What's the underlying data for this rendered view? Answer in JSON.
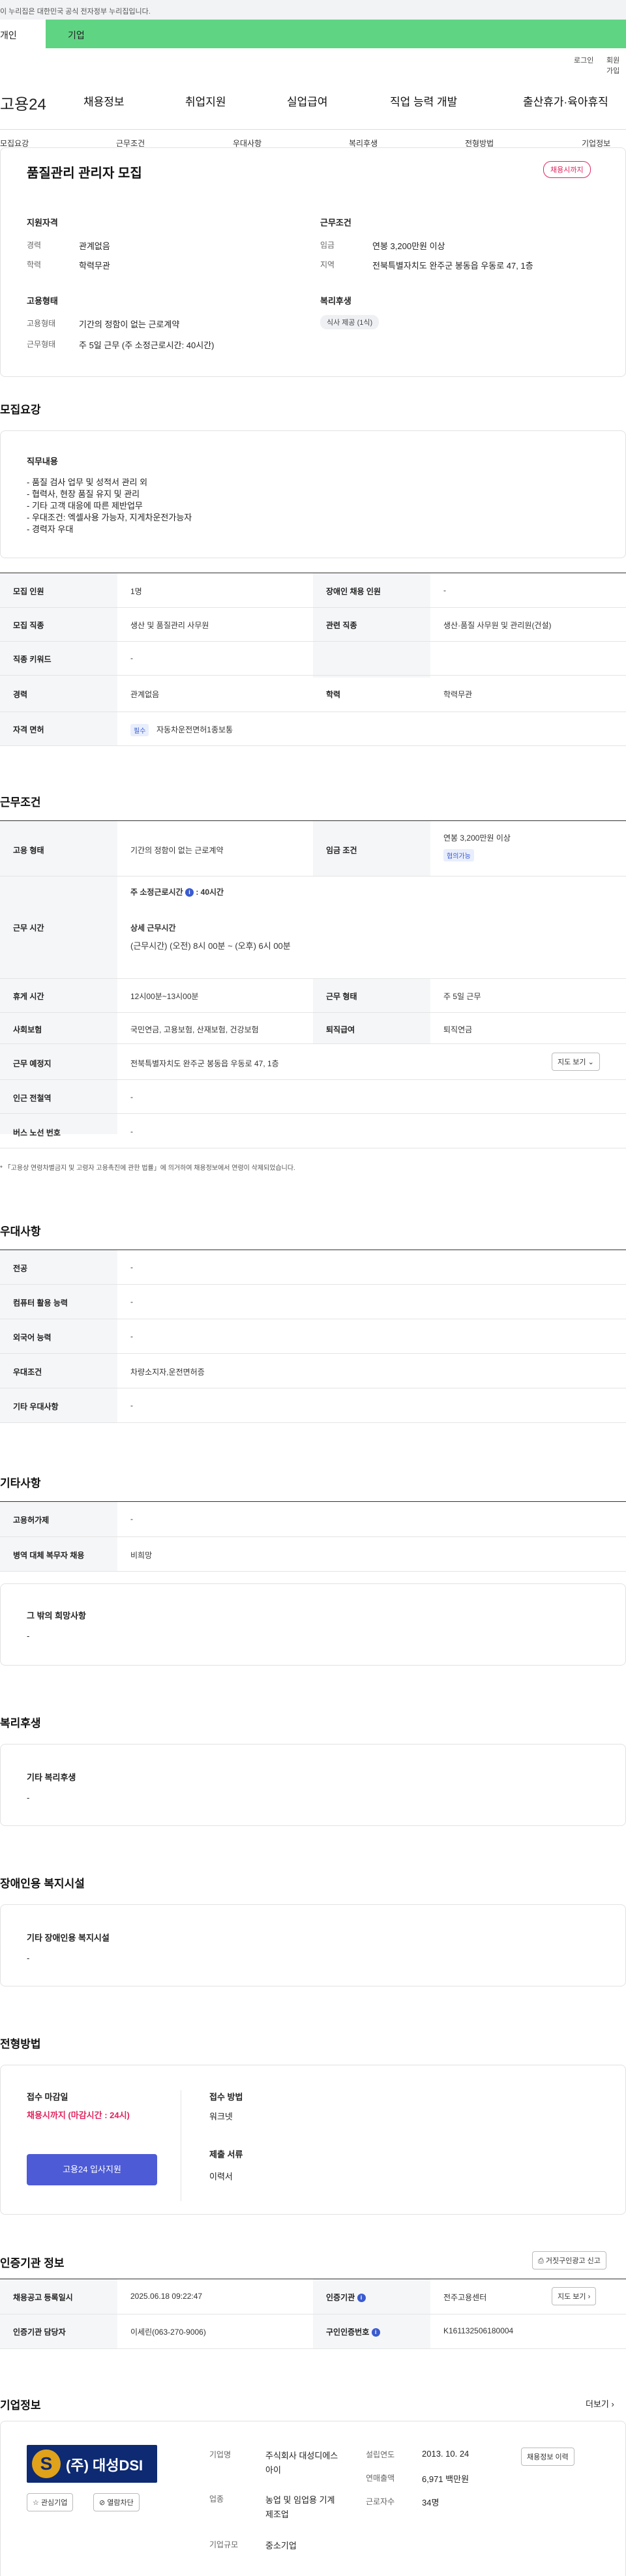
{
  "gov_banner": {
    "text": "이 누리집은 대한민국 공식 전자정부 누리집입니다."
  },
  "site_tabs": {
    "individual": "개인",
    "corporate": "기업"
  },
  "util": {
    "login": "로그인",
    "join": "회원가입"
  },
  "logo": {
    "text": "고용24"
  },
  "gnb": [
    "채용정보",
    "취업지원",
    "실업급여",
    "직업 능력 개발",
    "출산휴가·육아휴직"
  ],
  "subnav": [
    "모집요강",
    "근무조건",
    "우대사항",
    "복리후생",
    "전형방법",
    "기업정보"
  ],
  "summary": {
    "title": "품질관리 관리자 모집",
    "status_badge": "채용시까지",
    "qual_title": "지원자격",
    "career_label": "경력",
    "career_value": "관계없음",
    "edu_label": "학력",
    "edu_value": "학력무관",
    "cond_title": "근무조건",
    "wage_label": "임금",
    "wage_value": "연봉 3,200만원 이상",
    "region_label": "지역",
    "region_value": "전북특별자치도 완주군 봉동읍 우동로 47, 1층",
    "emp_title": "고용형태",
    "emptype_label": "고용형태",
    "emptype_value": "기간의 정함이 없는 근로계약",
    "worktype_label": "근무형태",
    "worktype_value": "주 5일 근무 (주 소정근로시간: 40시간)",
    "welfare_title": "복리후생",
    "welfare_chip": "식사 제공 (1식)"
  },
  "recruit": {
    "heading": "모집요강",
    "duty_title": "직무내용",
    "duty_lines": [
      "- 품질 검사 업무 및 성적서 관리 외",
      "- 협력사, 현장 품질 유지 및 관리",
      "- 기타 고객 대응에 따른 제반업무",
      "- 우대조건: 엑셀사용 가능자, 지게차운전가능자",
      "- 경력자 우대"
    ],
    "headcount_label": "모집 인원",
    "headcount_value": "1명",
    "disabled_label": "장애인 채용 인원",
    "disabled_value": "-",
    "job_label": "모집 직종",
    "job_value": "생산 및 품질관리 사무원",
    "related_label": "관련 직종",
    "related_value": "생산·품질 사무원 및 관리원(건설)",
    "keyword_label": "직종 키워드",
    "keyword_value": "-",
    "career_label": "경력",
    "career_value": "관계없음",
    "edu_label": "학력",
    "edu_value": "학력무관",
    "license_label": "자격 면허",
    "license_chip": "필수",
    "license_value": "자동차운전면허1종보통"
  },
  "conditions": {
    "heading": "근무조건",
    "emptype_label": "고용 형태",
    "emptype_value": "기간의 정함이 없는 근로계약",
    "wage_label": "임금 조건",
    "wage_value": "연봉 3,200만원 이상",
    "wage_chip": "협의가능",
    "hours_label": "근무 시간",
    "hours_week_title": "주 소정근로시간",
    "hours_week_value": ": 40시간",
    "hours_detail_title": "상세 근무시간",
    "hours_detail_value": "(근무시간) (오전) 8시 00분 ~ (오후) 6시 00분",
    "break_label": "휴게 시간",
    "break_value": "12시00분~13시00분",
    "worktype_label": "근무 형태",
    "worktype_value": "주 5일 근무",
    "insurance_label": "사회보험",
    "insurance_value": "국민연금, 고용보험, 산재보험, 건강보험",
    "retire_label": "퇴직급여",
    "retire_value": "퇴직연금",
    "place_label": "근무 예정지",
    "place_value": "전북특별자치도 완주군 봉동읍 우동로 47, 1층",
    "map_button": "지도 보기",
    "subway_label": "인근 전철역",
    "subway_value": "-",
    "bus_label": "버스 노선 번호",
    "bus_value": "-",
    "footnote": "* 「고용상 연령차별금지 및 고령자 고용촉진에 관한 법률」에 의거하여 채용정보에서 연령이 삭제되었습니다."
  },
  "preference": {
    "heading": "우대사항",
    "rows": [
      {
        "label": "전공",
        "value": "-"
      },
      {
        "label": "컴퓨터 활용 능력",
        "value": "-"
      },
      {
        "label": "외국어 능력",
        "value": "-"
      },
      {
        "label": "우대조건",
        "value": "차량소지자,운전면허증"
      },
      {
        "label": "기타 우대사항",
        "value": "-"
      }
    ]
  },
  "other": {
    "heading": "기타사항",
    "rows": [
      {
        "label": "고용허가제",
        "value": "-"
      },
      {
        "label": "병역 대체 복무자 채용",
        "value": "비희망"
      }
    ],
    "wish_title": "그 밖의 희망사항",
    "wish_value": "-"
  },
  "welfare": {
    "heading": "복리후생",
    "title": "기타 복리후생",
    "value": "-"
  },
  "disability": {
    "heading": "장애인용 복지시설",
    "title": "기타 장애인용 복지시설",
    "value": "-"
  },
  "selection": {
    "heading": "전형방법",
    "deadline_title": "접수 마감일",
    "deadline_value": "채용시까지 (마감시간 : 24시)",
    "apply_button": "고용24 입사지원",
    "method_title": "접수 방법",
    "method_value": "워크넷",
    "docs_title": "제출 서류",
    "docs_value": "이력서"
  },
  "agency": {
    "heading": "인증기관 정보",
    "report_button": "거짓구인광고 신고",
    "reg_label": "채용공고 등록일시",
    "reg_value": "2025.06.18 09:22:47",
    "agency_label": "인증기관",
    "agency_value": "전주고용센터",
    "map_button": "지도 보기",
    "manager_label": "인증기관 담당자",
    "manager_value": "이세린(063-270-9006)",
    "auth_label": "구인인증번호",
    "auth_value": "K161132506180004"
  },
  "company": {
    "heading": "기업정보",
    "more": "더보기",
    "logo_text": "(주) 대성DSI",
    "fav_button": "관심기업",
    "block_button": "열람차단",
    "name_label": "기업명",
    "name_value": "주식회사 대성디에스아이",
    "industry_label": "업종",
    "industry_value": "농업 및 임업용 기계 제조업",
    "size_label": "기업규모",
    "size_value": "중소기업",
    "founded_label": "설립연도",
    "founded_value": "2013. 10. 24",
    "sales_label": "연매출액",
    "sales_value": "6,971 백만원",
    "staff_label": "근로자수",
    "staff_value": "34명",
    "history_button": "채용정보 이력"
  },
  "colors": {
    "accent": "#5fd483",
    "brand": "#4d5bd6",
    "alert": "#e0245e"
  }
}
